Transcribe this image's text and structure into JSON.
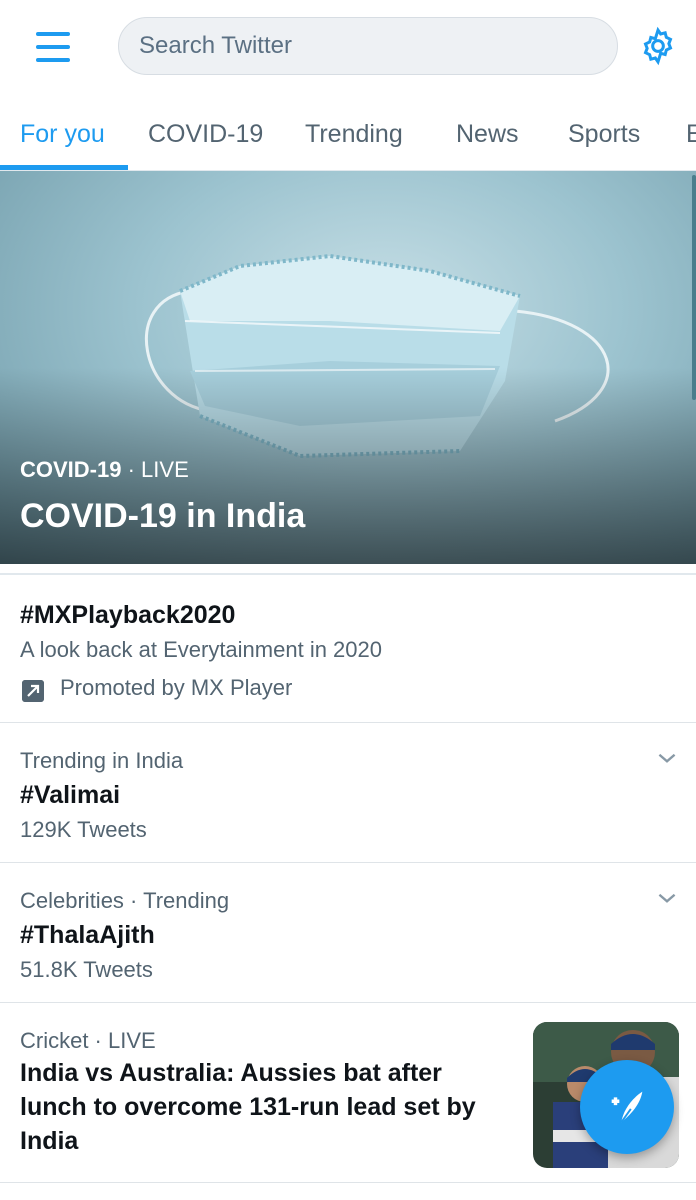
{
  "header": {
    "search_placeholder": "Search Twitter",
    "accent_color": "#1d9bf0"
  },
  "tabs": [
    {
      "label": "For you",
      "active": true
    },
    {
      "label": "COVID-19",
      "active": false
    },
    {
      "label": "Trending",
      "active": false
    },
    {
      "label": "News",
      "active": false
    },
    {
      "label": "Sports",
      "active": false
    },
    {
      "label": "E",
      "active": false
    }
  ],
  "hero": {
    "category": "COVID-19",
    "separator": " · ",
    "status": "LIVE",
    "title": "COVID-19 in India"
  },
  "trends": [
    {
      "title": "#MXPlayback2020",
      "description": "A look back at Everytainment in 2020",
      "promoted": "Promoted by MX Player"
    },
    {
      "context": "Trending in India",
      "title": "#Valimai",
      "count": "129K Tweets"
    },
    {
      "context": "Celebrities · Trending",
      "title": "#ThalaAjith",
      "count": "51.8K Tweets"
    }
  ],
  "news": {
    "context": "Cricket · LIVE",
    "title": "India vs Australia: Aussies bat after lunch to overcome 131-run lead set by India"
  },
  "icons": {
    "menu": "hamburger-menu-icon",
    "settings": "gear-icon",
    "promoted": "promoted-arrow-icon",
    "expand": "chevron-down-icon",
    "compose": "compose-tweet-icon"
  }
}
